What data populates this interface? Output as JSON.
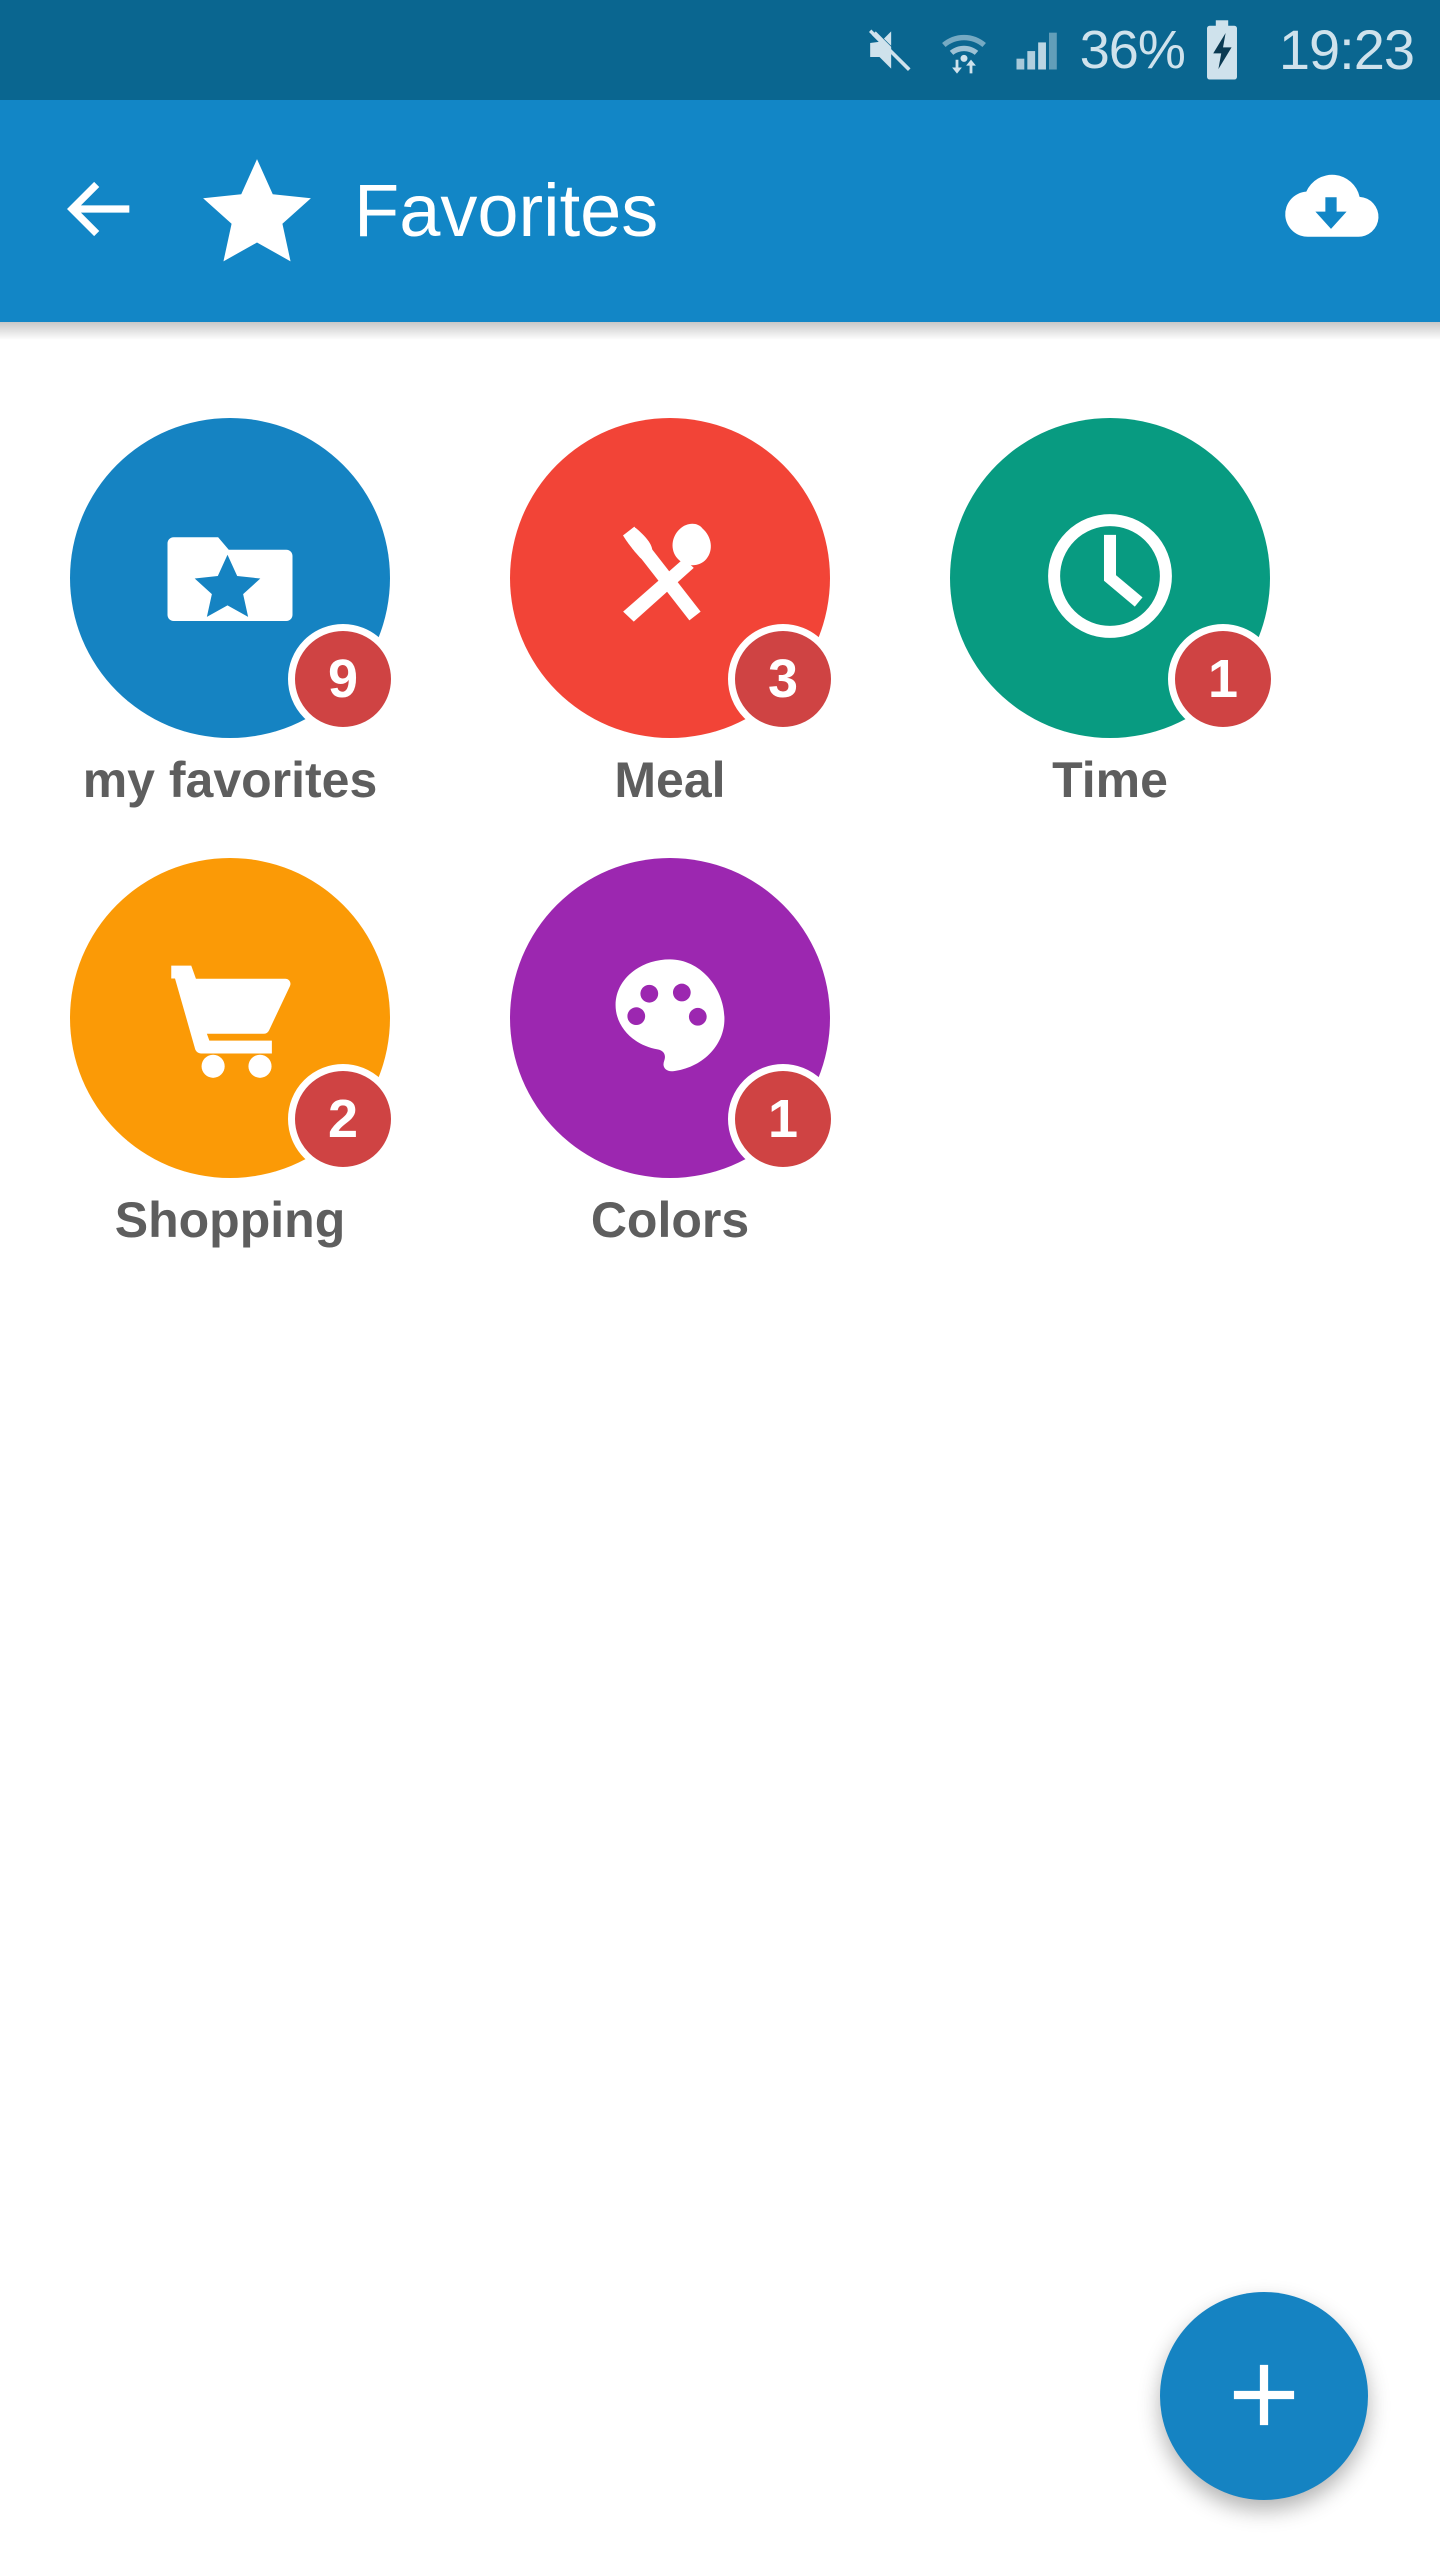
{
  "status_bar": {
    "background_color": "#0a6690",
    "text_color": "#cfe2ec",
    "mute_icon": "mute-icon",
    "wifi_icon": "wifi-transfer-icon",
    "signal_icon": "cellular-signal-icon",
    "battery_percent": "36%",
    "battery_icon": "battery-charging-icon",
    "time": "19:23"
  },
  "app_bar": {
    "background_color": "#1286c6",
    "back_icon": "back-arrow-icon",
    "star_icon": "star-icon",
    "title": "Favorites",
    "download_icon": "cloud-download-icon"
  },
  "main": {
    "background_color": "#ffffff",
    "items": [
      {
        "label": "my favorites",
        "badge": "9",
        "color": "#1583c2",
        "icon": "folder-star-icon"
      },
      {
        "label": "Meal",
        "badge": "3",
        "color": "#f24437",
        "icon": "cutlery-icon"
      },
      {
        "label": "Time",
        "badge": "1",
        "color": "#089b81",
        "icon": "clock-icon"
      },
      {
        "label": "Shopping",
        "badge": "2",
        "color": "#fb9a06",
        "icon": "shopping-cart-icon"
      },
      {
        "label": "Colors",
        "badge": "1",
        "color": "#9c27b0",
        "icon": "palette-icon"
      }
    ],
    "badge_color": "#cf4343",
    "label_color": "#5e5e5e"
  },
  "fab": {
    "icon": "plus-icon",
    "color": "#1583c2",
    "label": "+"
  }
}
